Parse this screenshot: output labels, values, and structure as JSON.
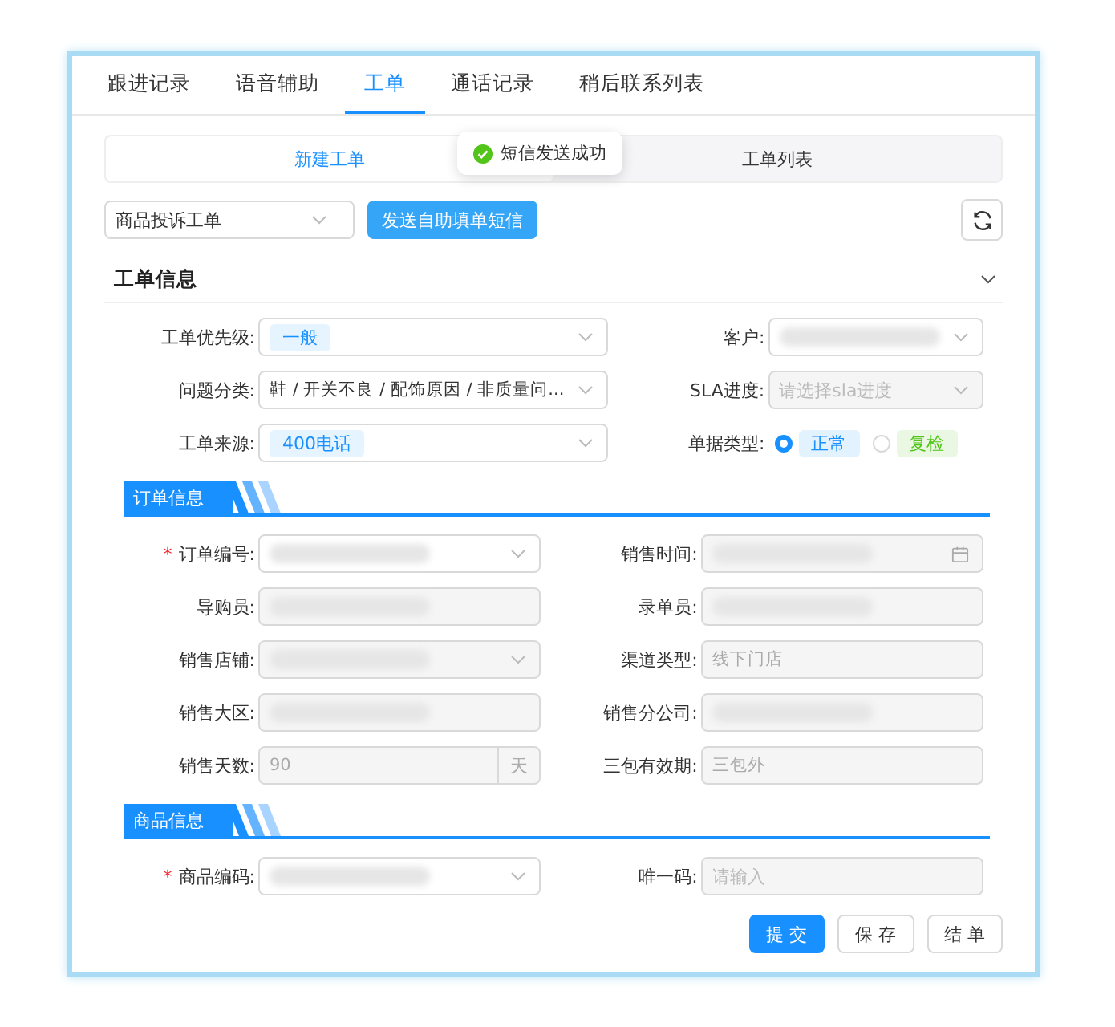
{
  "tabs": [
    {
      "label": "跟进记录",
      "selected": false
    },
    {
      "label": "语音辅助",
      "selected": false
    },
    {
      "label": "工单",
      "selected": true
    },
    {
      "label": "通话记录",
      "selected": false
    },
    {
      "label": "稍后联系列表",
      "selected": false
    }
  ],
  "subtabs": [
    {
      "label": "新建工单",
      "selected": true
    },
    {
      "label": "工单列表",
      "selected": false
    }
  ],
  "toast": {
    "text": "短信发送成功"
  },
  "toolbar": {
    "type_select": "商品投诉工单",
    "send_button": "发送自助填单短信"
  },
  "sections": [
    {
      "title": "工单信息",
      "kind": "collapsible",
      "expanded": true,
      "fields": [
        {
          "label": "工单优先级:",
          "kind": "select",
          "tag": "一般"
        },
        {
          "label": "客户:",
          "kind": "select",
          "redacted": true
        },
        {
          "label": "问题分类:",
          "kind": "select",
          "value": "鞋 / 开关不良 / 配饰原因 / 非质量问..."
        },
        {
          "label": "SLA进度:",
          "kind": "select",
          "disabled": true,
          "placeholder": "请选择sla进度"
        },
        {
          "label": "工单来源:",
          "kind": "select",
          "tag": "400电话"
        },
        {
          "label": "单据类型:",
          "kind": "radio",
          "options": [
            {
              "label": "正常",
              "selected": true,
              "color": "#1890ff"
            },
            {
              "label": "复检",
              "selected": false,
              "color": "#52c41a"
            }
          ]
        }
      ]
    },
    {
      "title": "订单信息",
      "kind": "banner",
      "fields": [
        {
          "label": "订单编号:",
          "kind": "select",
          "required_mark": "*",
          "redacted": true
        },
        {
          "label": "销售时间:",
          "kind": "date",
          "disabled": true,
          "redacted": true
        },
        {
          "label": "导购员:",
          "kind": "input",
          "disabled": true,
          "redacted": true
        },
        {
          "label": "录单员:",
          "kind": "input",
          "disabled": true,
          "redacted": true
        },
        {
          "label": "销售店铺:",
          "kind": "select",
          "disabled": true,
          "redacted": true
        },
        {
          "label": "渠道类型:",
          "kind": "input",
          "disabled": true,
          "value": "线下门店"
        },
        {
          "label": "销售大区:",
          "kind": "input",
          "disabled": true,
          "redacted": true
        },
        {
          "label": "销售分公司:",
          "kind": "input",
          "disabled": true,
          "redacted": true
        },
        {
          "label": "销售天数:",
          "kind": "input",
          "disabled": true,
          "value": "90",
          "suffix": "天"
        },
        {
          "label": "三包有效期:",
          "kind": "input",
          "disabled": true,
          "value": "三包外"
        }
      ]
    },
    {
      "title": "商品信息",
      "kind": "banner",
      "fields": [
        {
          "label": "商品编码:",
          "kind": "select",
          "required_mark": "*",
          "redacted": true
        },
        {
          "label": "唯一码:",
          "kind": "input",
          "disabled": true,
          "placeholder": "请输入"
        }
      ]
    }
  ],
  "footer": [
    {
      "label": "提 交",
      "kind": "primary"
    },
    {
      "label": "保 存",
      "kind": "default"
    },
    {
      "label": "结 单",
      "kind": "default"
    }
  ]
}
